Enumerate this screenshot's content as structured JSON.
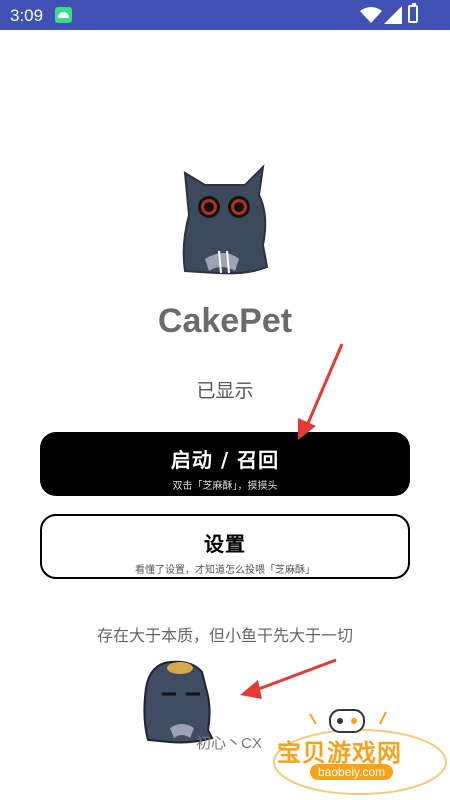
{
  "status_bar": {
    "time": "3:09"
  },
  "app": {
    "title": "CakePet",
    "status": "已显示"
  },
  "buttons": {
    "start": {
      "label": "启动 / 召回",
      "sub": "双击「芝麻酥」，摸摸头"
    },
    "settings": {
      "label": "设置",
      "sub": "看懂了设置，才知道怎么投喂「芝麻酥」"
    }
  },
  "motto": "存在大于本质，但小鱼干先大于一切",
  "author": "初心丶CX",
  "watermark": {
    "text": "宝贝游戏网",
    "url": "baobeiy.com"
  },
  "colors": {
    "status_bar": "#3f51b5",
    "arrow": "#e53935",
    "watermark": "#f6a31b"
  },
  "icons": [
    "android-icon",
    "wifi-icon",
    "signal-icon",
    "battery-icon",
    "cat-icon"
  ]
}
